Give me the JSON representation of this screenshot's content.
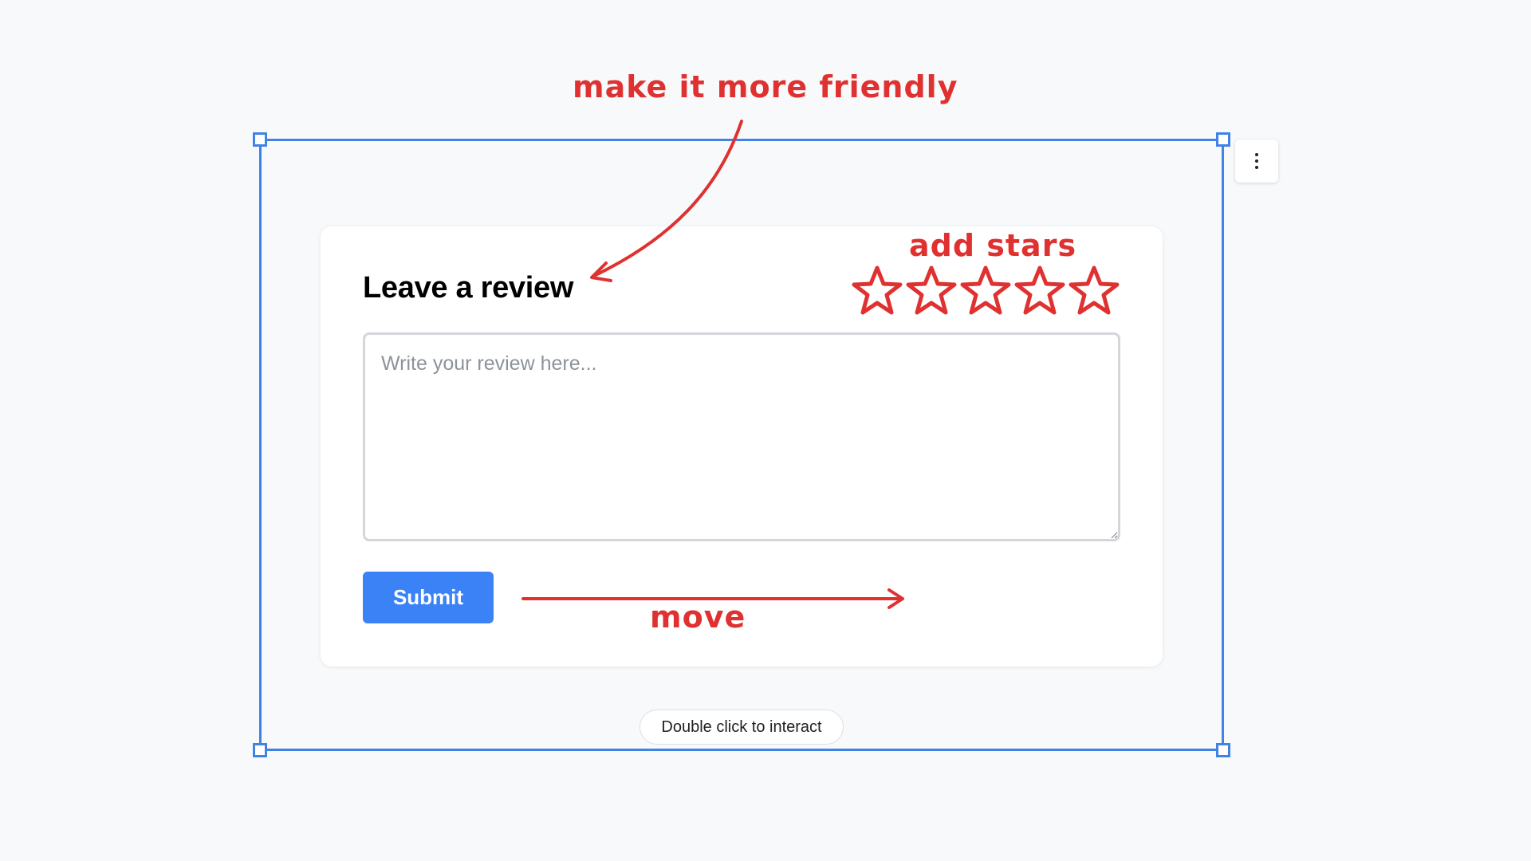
{
  "card": {
    "title": "Leave a review",
    "textarea_placeholder": "Write your review here...",
    "submit_label": "Submit"
  },
  "hint": {
    "label": "Double click to interact"
  },
  "annotations": {
    "friendly": "make it more friendly",
    "stars": "add stars",
    "move": "move",
    "color": "#e03131"
  },
  "stars": {
    "count": 5,
    "icon": "star-outline-icon"
  },
  "menu": {
    "icon": "kebab-menu-icon"
  },
  "colors": {
    "selection": "#3f83e6",
    "submit": "#3b82f6",
    "background": "#f8f9fb"
  }
}
